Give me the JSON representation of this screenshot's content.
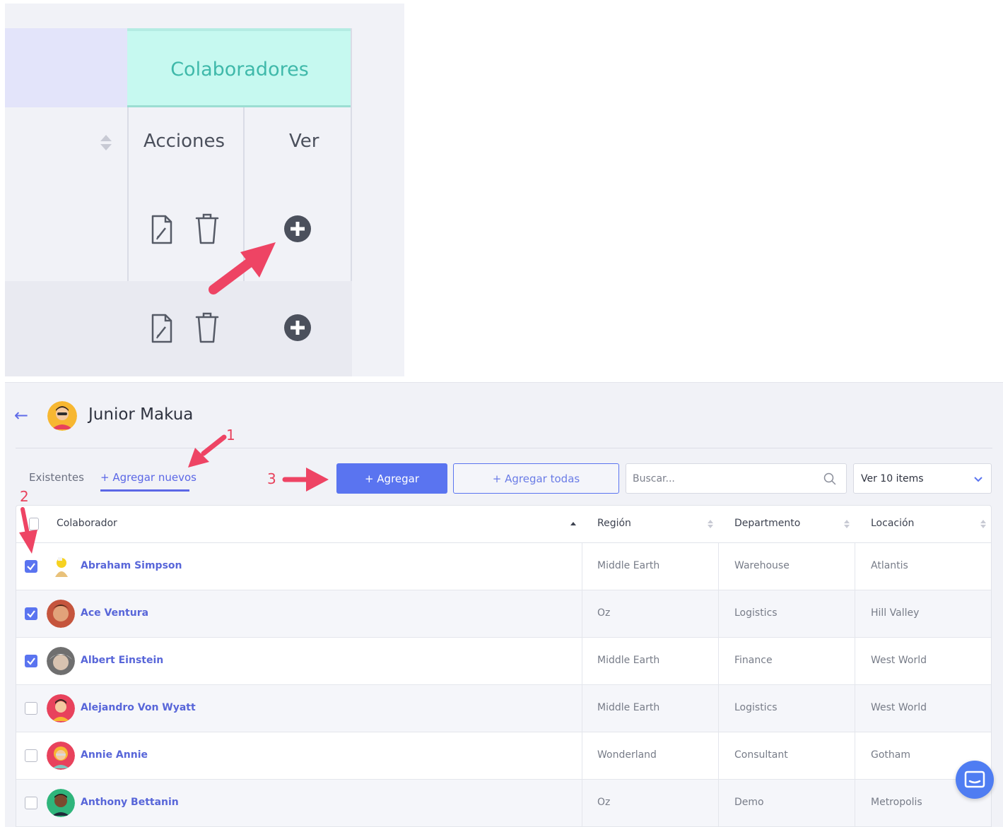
{
  "zoom": {
    "group_header": "Colaboradores",
    "col_actions": "Acciones",
    "col_view": "Ver"
  },
  "header": {
    "user_name": "Junior Makua"
  },
  "tabs": [
    {
      "label": "Existentes"
    },
    {
      "label": "+ Agregar nuevos"
    }
  ],
  "toolbar": {
    "add_label": "+ Agregar",
    "add_all_label": "+ Agregar todas",
    "search_placeholder": "Buscar...",
    "page_size_label": "Ver 10 items"
  },
  "annotations": [
    "1",
    "2",
    "3"
  ],
  "table": {
    "columns": [
      "Colaborador",
      "Región",
      "Departmento",
      "Locación"
    ],
    "rows": [
      {
        "name": "Abraham Simpson",
        "region": "Middle Earth",
        "dept": "Warehouse",
        "loc": "Atlantis",
        "checked": true
      },
      {
        "name": "Ace Ventura",
        "region": "Oz",
        "dept": "Logistics",
        "loc": "Hill Valley",
        "checked": true
      },
      {
        "name": "Albert Einstein",
        "region": "Middle Earth",
        "dept": "Finance",
        "loc": "West World",
        "checked": true
      },
      {
        "name": "Alejandro Von Wyatt",
        "region": "Middle Earth",
        "dept": "Logistics",
        "loc": "West World",
        "checked": false
      },
      {
        "name": "Annie Annie",
        "region": "Wonderland",
        "dept": "Consultant",
        "loc": "Gotham",
        "checked": false
      },
      {
        "name": "Anthony Bettanin",
        "region": "Oz",
        "dept": "Demo",
        "loc": "Metropolis",
        "checked": false
      }
    ]
  },
  "colors": {
    "primary": "#5a74f0",
    "accent_teal": "#3fb9aa",
    "annotation": "#e8425c"
  }
}
